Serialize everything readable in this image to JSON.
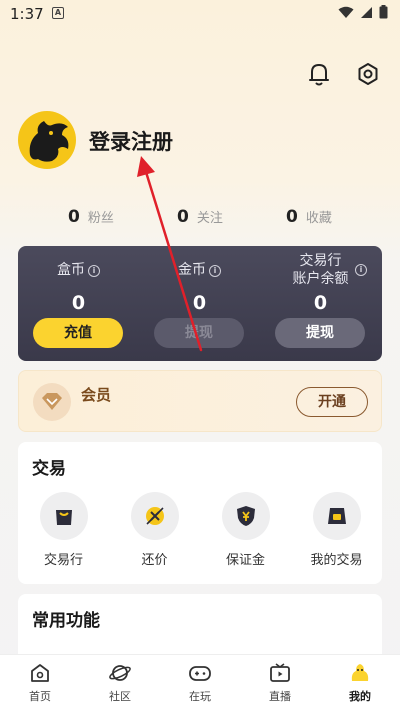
{
  "status": {
    "time": "1:37",
    "a_label": "A"
  },
  "profile": {
    "login_label": "登录注册"
  },
  "stats": [
    {
      "num": "0",
      "label": "粉丝"
    },
    {
      "num": "0",
      "label": "关注"
    },
    {
      "num": "0",
      "label": "收藏"
    }
  ],
  "wallet": {
    "box_coin": {
      "label": "盒币",
      "value": "0",
      "button": "充值"
    },
    "gold_coin": {
      "label": "金币",
      "value": "0",
      "button": "提现"
    },
    "trade_balance": {
      "label_line1": "交易行",
      "label_line2": "账户余额",
      "value": "0",
      "button": "提现"
    },
    "info_glyph": "i"
  },
  "member": {
    "label": "会员",
    "button": "开通"
  },
  "trade_section": {
    "title": "交易",
    "items": [
      {
        "label": "交易行",
        "icon": "bag-icon"
      },
      {
        "label": "还价",
        "icon": "bargain-icon"
      },
      {
        "label": "保证金",
        "icon": "shield-yen-icon"
      },
      {
        "label": "我的交易",
        "icon": "my-trade-icon"
      }
    ]
  },
  "common_section": {
    "title": "常用功能"
  },
  "tabbar": [
    {
      "label": "首页",
      "icon": "home-icon"
    },
    {
      "label": "社区",
      "icon": "planet-icon"
    },
    {
      "label": "在玩",
      "icon": "gamepad-icon"
    },
    {
      "label": "直播",
      "icon": "tv-icon"
    },
    {
      "label": "我的",
      "icon": "mascot-icon",
      "active": true
    }
  ],
  "colors": {
    "accent": "#fbd32f",
    "wallet_bg": "#403f50",
    "annotation_arrow": "#e0202a"
  }
}
